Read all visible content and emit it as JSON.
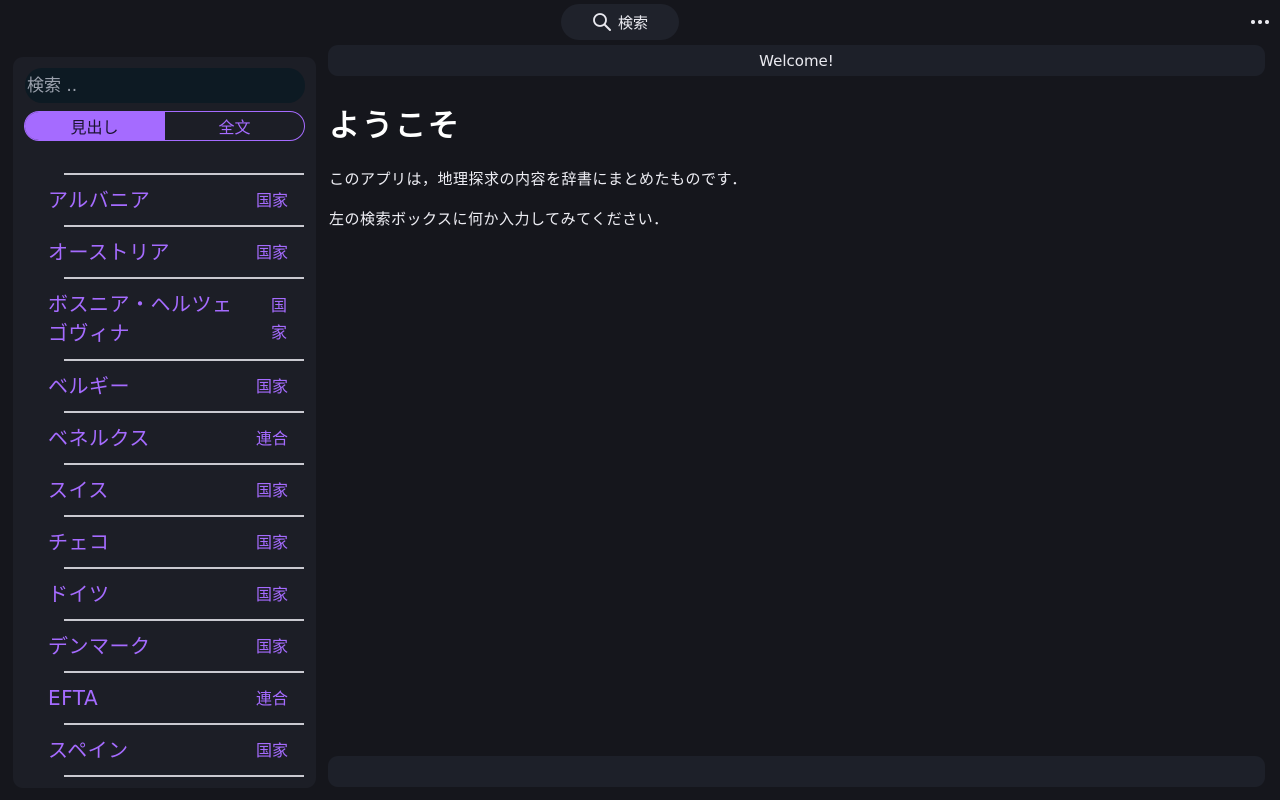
{
  "topbar": {
    "search_label": "検索"
  },
  "sidebar": {
    "search_placeholder": "検索 ..",
    "modes": [
      {
        "label": "見出し",
        "active": true
      },
      {
        "label": "全文",
        "active": false
      }
    ],
    "entries": [
      {
        "name": "アルバニア",
        "category": "国家"
      },
      {
        "name": "オーストリア",
        "category": "国家"
      },
      {
        "name": "ボスニア・ヘルツェゴヴィナ",
        "category": "国家"
      },
      {
        "name": "ベルギー",
        "category": "国家"
      },
      {
        "name": "ベネルクス",
        "category": "連合"
      },
      {
        "name": "スイス",
        "category": "国家"
      },
      {
        "name": "チェコ",
        "category": "国家"
      },
      {
        "name": "ドイツ",
        "category": "国家"
      },
      {
        "name": "デンマーク",
        "category": "国家"
      },
      {
        "name": "EFTA",
        "category": "連合"
      },
      {
        "name": "スペイン",
        "category": "国家"
      }
    ]
  },
  "main": {
    "header": "Welcome!",
    "title": "ようこそ",
    "paragraphs": [
      "このアプリは，地理探求の内容を辞書にまとめたものです．",
      "左の検索ボックスに何か入力してみてください．"
    ]
  },
  "colors": {
    "accent": "#a56bff",
    "background": "#15161c",
    "panel": "#1c1e26"
  }
}
